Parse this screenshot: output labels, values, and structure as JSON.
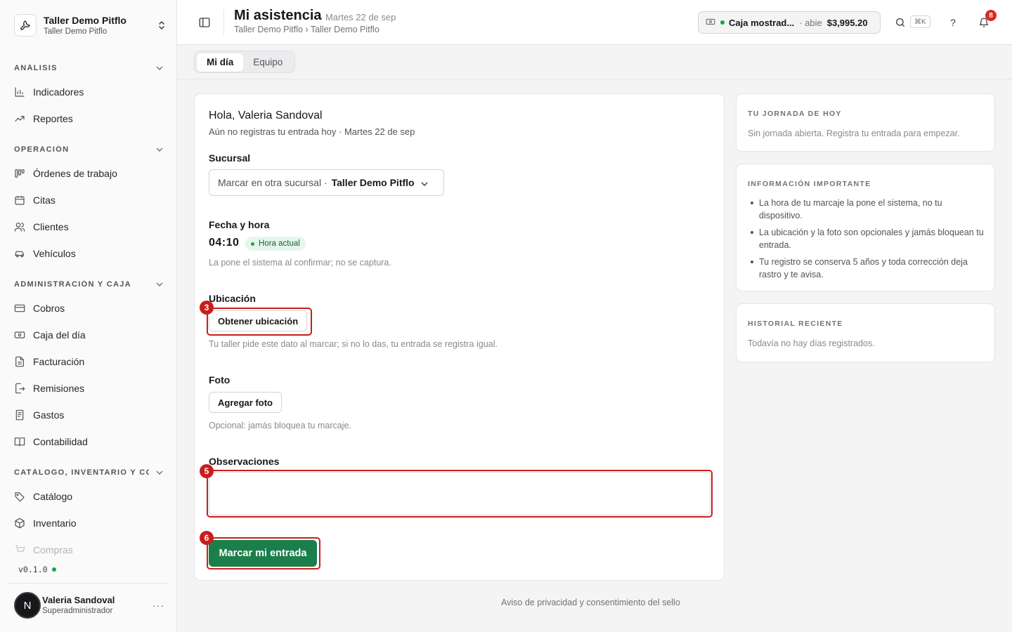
{
  "workspace": {
    "name": "Taller Demo Pitflo",
    "sub": "Taller Demo Pitflo"
  },
  "sidebar": {
    "sections": [
      {
        "title": "ANÁLISIS",
        "items": [
          {
            "label": "Indicadores",
            "icon": "bar-chart-icon"
          },
          {
            "label": "Reportes",
            "icon": "trending-up-icon"
          }
        ]
      },
      {
        "title": "OPERACIÓN",
        "items": [
          {
            "label": "Órdenes de trabajo",
            "icon": "kanban-icon"
          },
          {
            "label": "Citas",
            "icon": "calendar-icon"
          },
          {
            "label": "Clientes",
            "icon": "users-icon"
          },
          {
            "label": "Vehículos",
            "icon": "car-icon"
          }
        ]
      },
      {
        "title": "ADMINISTRACIÓN Y CAJA",
        "items": [
          {
            "label": "Cobros",
            "icon": "credit-card-icon"
          },
          {
            "label": "Caja del día",
            "icon": "banknote-icon"
          },
          {
            "label": "Facturación",
            "icon": "file-text-icon"
          },
          {
            "label": "Remisiones",
            "icon": "file-export-icon"
          },
          {
            "label": "Gastos",
            "icon": "receipt-icon"
          },
          {
            "label": "Contabilidad",
            "icon": "book-icon"
          }
        ]
      },
      {
        "title": "CATÁLOGO, INVENTARIO Y CO...",
        "items": [
          {
            "label": "Catálogo",
            "icon": "tag-icon"
          },
          {
            "label": "Inventario",
            "icon": "box-icon"
          },
          {
            "label": "Compras",
            "icon": "cart-icon"
          }
        ]
      }
    ],
    "version": "v0.1.0",
    "user": {
      "initial": "N",
      "name": "Valeria Sandoval",
      "role": "Superadministrador",
      "more": "···"
    }
  },
  "topbar": {
    "title": "Mi asistencia",
    "date": "· Martes 22 de sep",
    "breadcrumb": "Taller Demo Pitflo › Taller Demo Pitflo",
    "caja": {
      "name": "Caja mostrad...",
      "status": "· abie",
      "amount": "$3,995.20",
      "status_color": "#16a34a"
    },
    "shortcut": "⌘K",
    "help": "?",
    "notifications": "8"
  },
  "tabs": [
    "Mi día",
    "Equipo"
  ],
  "form": {
    "greeting": "Hola, Valeria Sandoval",
    "subtitle": "Aún no registras tu entrada hoy · Martes 22 de sep",
    "branch": {
      "label": "Sucursal",
      "prefix": "Marcar en otra sucursal ·",
      "value": "Taller Demo Pitflo"
    },
    "datetime": {
      "label": "Fecha y hora",
      "time": "04:10",
      "badge": "Hora actual",
      "hint": "La pone el sistema al confirmar; no se captura."
    },
    "location": {
      "label": "Ubicación",
      "button": "Obtener ubicación",
      "hint": "Tu taller pide este dato al marcar; si no lo das, tu entrada se registra igual.",
      "marker": "3"
    },
    "photo": {
      "label": "Foto",
      "button": "Agregar foto",
      "hint": "Opcional: jamás bloquea tu marcaje."
    },
    "notes": {
      "label": "Observaciones",
      "value": "",
      "marker": "5"
    },
    "submit": {
      "label": "Marcar mi entrada",
      "marker": "6",
      "color": "#1a7f4b"
    }
  },
  "right": {
    "today": {
      "title": "TU JORNADA DE HOY",
      "text": "Sin jornada abierta. Registra tu entrada para empezar."
    },
    "info": {
      "title": "INFORMACIÓN IMPORTANTE",
      "items": [
        "La hora de tu marcaje la pone el sistema, no tu dispositivo.",
        "La ubicación y la foto son opcionales y jamás bloquean tu entrada.",
        "Tu registro se conserva 5 años y toda corrección deja rastro y te avisa."
      ]
    },
    "history": {
      "title": "HISTORIAL RECIENTE",
      "text": "Todavía no hay días registrados."
    }
  },
  "footer": "Aviso de privacidad y consentimiento del sello",
  "colors": {
    "accent": "#1a7f4b",
    "highlight": "#c81e1e"
  }
}
